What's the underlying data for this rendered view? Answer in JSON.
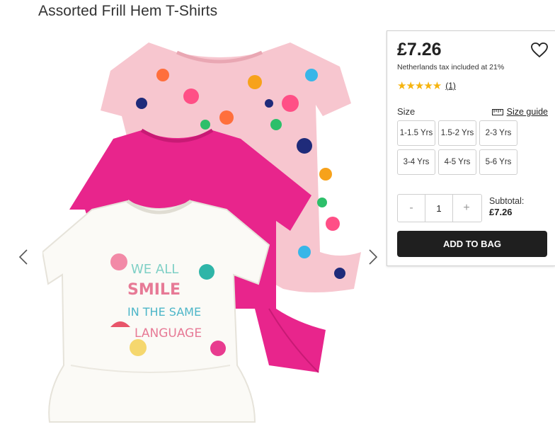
{
  "product": {
    "title": "Assorted Frill Hem T-Shirts",
    "shirt_print": [
      "WE ALL",
      "SMILE",
      "IN THE SAME",
      "LANGUAGE"
    ]
  },
  "gallery": {
    "prev_icon": "chevron-left-icon",
    "next_icon": "chevron-right-icon"
  },
  "purchase": {
    "price": "£7.26",
    "tax_note": "Netherlands tax included at 21%",
    "rating": {
      "stars": 5,
      "stars_display": "★★★★★",
      "review_count": "(1)"
    },
    "size_label": "Size",
    "size_guide_label": "Size guide",
    "sizes": [
      "1-1.5 Yrs",
      "1.5-2 Yrs",
      "2-3 Yrs",
      "3-4 Yrs",
      "4-5 Yrs",
      "5-6 Yrs"
    ],
    "quantity": {
      "minus": "-",
      "value": "1",
      "plus": "+"
    },
    "subtotal_label": "Subtotal:",
    "subtotal_value": "£7.26",
    "add_to_bag": "ADD TO BAG"
  },
  "colors": {
    "star": "#f6b40e",
    "button_dark": "#1f1f1f",
    "shirt_pink": "#e8258c",
    "shirt_floral": "#f7c6cf",
    "shirt_white": "#fbfaf6"
  }
}
